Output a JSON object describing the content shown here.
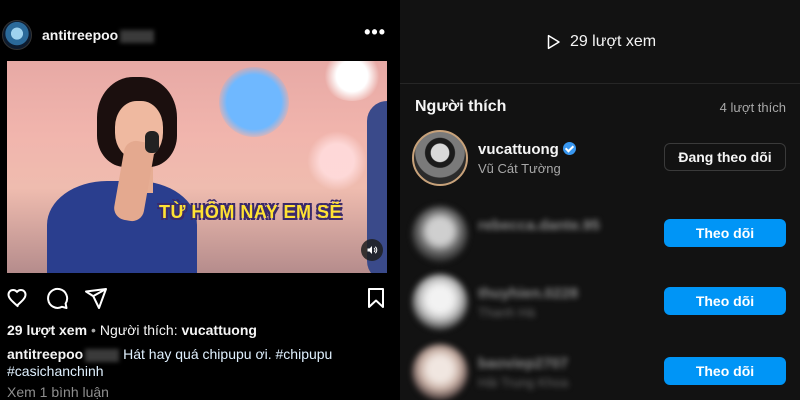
{
  "post": {
    "username": "antitreepoo",
    "more_label": "•••",
    "video_caption": "TỪ HÔM NAY EM SẼ",
    "views": "29 lượt xem",
    "liked_by_prefix": "Người thích:",
    "liked_by_user": "vucattuong",
    "caption_user": "antitreepoo",
    "caption_text": "Hát hay quá chipupu ơi. #chipupu",
    "caption_text2": "#casichanchinh",
    "comments_link": "Xem 1 bình luận"
  },
  "viewers_panel": {
    "views_label": "29 lượt xem",
    "likes_title": "Người thích",
    "likes_count": "4 lượt thích",
    "users": [
      {
        "username": "vucattuong",
        "fullname": "Vũ Cát Tường",
        "verified": true,
        "button": "Đang theo dõi"
      },
      {
        "username": "rebecca.dante.95",
        "fullname": "",
        "verified": false,
        "button": "Theo dõi"
      },
      {
        "username": "thuyhien.0228",
        "fullname": "Thanh Hà",
        "verified": false,
        "button": "Theo dõi"
      },
      {
        "username": "baoviep2707",
        "fullname": "Hải Trung Khoa",
        "verified": false,
        "button": "Theo dõi"
      }
    ]
  },
  "colors": {
    "follow_button": "#0095f6",
    "verified_badge": "#3897f0",
    "caption_yellow": "#ffe234"
  }
}
